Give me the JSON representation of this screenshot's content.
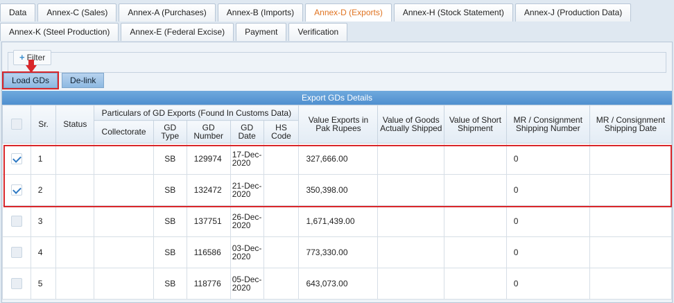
{
  "tabs_row1": [
    {
      "label": "Data",
      "active": false
    },
    {
      "label": "Annex-C (Sales)",
      "active": false
    },
    {
      "label": "Annex-A (Purchases)",
      "active": false
    },
    {
      "label": "Annex-B (Imports)",
      "active": false
    },
    {
      "label": "Annex-D (Exports)",
      "active": true
    },
    {
      "label": "Annex-H (Stock Statement)",
      "active": false
    },
    {
      "label": "Annex-J (Production Data)",
      "active": false
    }
  ],
  "tabs_row2": [
    {
      "label": "Annex-K (Steel Production)",
      "active": false
    },
    {
      "label": "Annex-E (Federal Excise)",
      "active": false
    },
    {
      "label": "Payment",
      "active": false
    },
    {
      "label": "Verification",
      "active": false
    }
  ],
  "filter": {
    "label": "Filter"
  },
  "buttons": {
    "load": "Load GDs",
    "delink": "De-link"
  },
  "grid": {
    "title": "Export GDs Details",
    "headers": {
      "sr": "Sr.",
      "status": "Status",
      "particulars": "Particulars of GD Exports (Found In Customs Data)",
      "collectorate": "Collectorate",
      "gd_type": "GD Type",
      "gd_number": "GD Number",
      "gd_date": "GD Date",
      "hs_code": "HS Code",
      "value_exports": "Value Exports in Pak Rupees",
      "value_goods": "Value of Goods Actually Shipped",
      "value_short": "Value of Short Shipment",
      "mr_number": "MR / Consignment Shipping Number",
      "mr_date": "MR / Consignment Shipping Date"
    },
    "rows": [
      {
        "checked": true,
        "sr": "1",
        "status": "",
        "collectorate": "",
        "gd_type": "SB",
        "gd_number": "129974",
        "gd_date": "17-Dec-2020",
        "hs_code": "",
        "value_exports": "327,666.00",
        "value_goods": "",
        "value_short": "",
        "mr_number": "0",
        "mr_date": ""
      },
      {
        "checked": true,
        "sr": "2",
        "status": "",
        "collectorate": "",
        "gd_type": "SB",
        "gd_number": "132472",
        "gd_date": "21-Dec-2020",
        "hs_code": "",
        "value_exports": "350,398.00",
        "value_goods": "",
        "value_short": "",
        "mr_number": "0",
        "mr_date": ""
      },
      {
        "checked": false,
        "sr": "3",
        "status": "",
        "collectorate": "",
        "gd_type": "SB",
        "gd_number": "137751",
        "gd_date": "26-Dec-2020",
        "hs_code": "",
        "value_exports": "1,671,439.00",
        "value_goods": "",
        "value_short": "",
        "mr_number": "0",
        "mr_date": ""
      },
      {
        "checked": false,
        "sr": "4",
        "status": "",
        "collectorate": "",
        "gd_type": "SB",
        "gd_number": "116586",
        "gd_date": "03-Dec-2020",
        "hs_code": "",
        "value_exports": "773,330.00",
        "value_goods": "",
        "value_short": "",
        "mr_number": "0",
        "mr_date": ""
      },
      {
        "checked": false,
        "sr": "5",
        "status": "",
        "collectorate": "",
        "gd_type": "SB",
        "gd_number": "118776",
        "gd_date": "05-Dec-2020",
        "hs_code": "",
        "value_exports": "643,073.00",
        "value_goods": "",
        "value_short": "",
        "mr_number": "0",
        "mr_date": ""
      }
    ]
  },
  "colors": {
    "accent_tab": "#e07320",
    "highlight": "#d9262a",
    "header_bar": "#4f8fcf"
  }
}
